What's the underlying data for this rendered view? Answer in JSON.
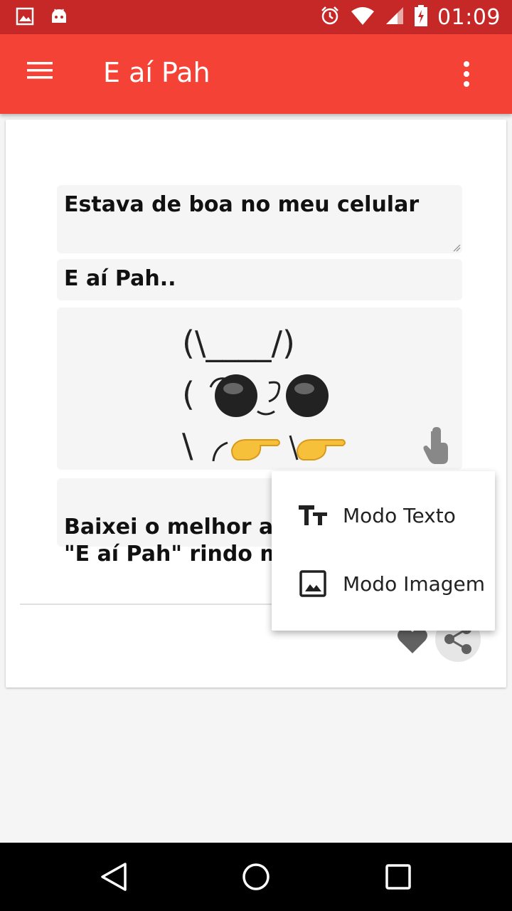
{
  "status_bar": {
    "time": "01:09"
  },
  "app_bar": {
    "title": "E aí Pah"
  },
  "card": {
    "top_text": "Estava de boa no meu celular",
    "middle_text": "E aí Pah..",
    "ascii_line1": "(\\____/)",
    "ascii_line2": "( ",
    "ascii_line3": "\\  ",
    "bottom_text": " Baixei o melhor apli\n\"E aí Pah\" rindo muit"
  },
  "popup_menu": {
    "items": [
      {
        "label": "Modo Texto",
        "icon": "text-format-icon"
      },
      {
        "label": "Modo Imagem",
        "icon": "image-icon"
      }
    ]
  },
  "colors": {
    "status_bar": "#c62828",
    "app_bar": "#f44336"
  }
}
